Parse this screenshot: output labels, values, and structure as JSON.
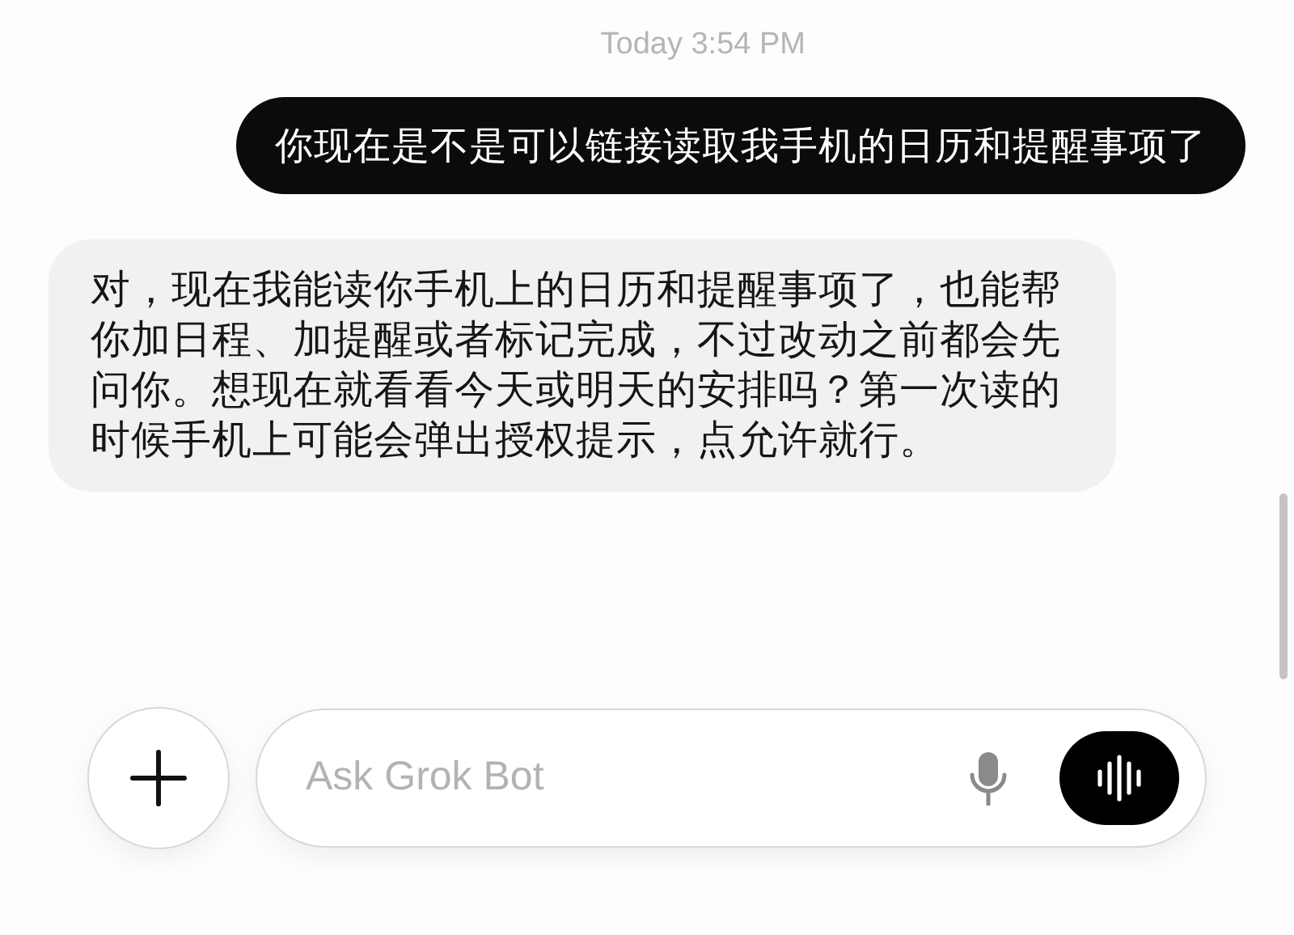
{
  "timestamp": "Today 3:54 PM",
  "messages": [
    {
      "kind": "user",
      "text": "你现在是不是可以链接读取我手机的日历和提醒事项了"
    },
    {
      "kind": "assistant",
      "text": "对，现在我能读你手机上的日历和提醒事项了，也能帮你加日程、加提醒或者标记完成，不过改动之前都会先问你。想现在就看看今天或明天的安排吗？第一次读的时候手机上可能会弹出授权提示，点允许就行。"
    }
  ],
  "composer": {
    "placeholder": "Ask Grok Bot"
  }
}
